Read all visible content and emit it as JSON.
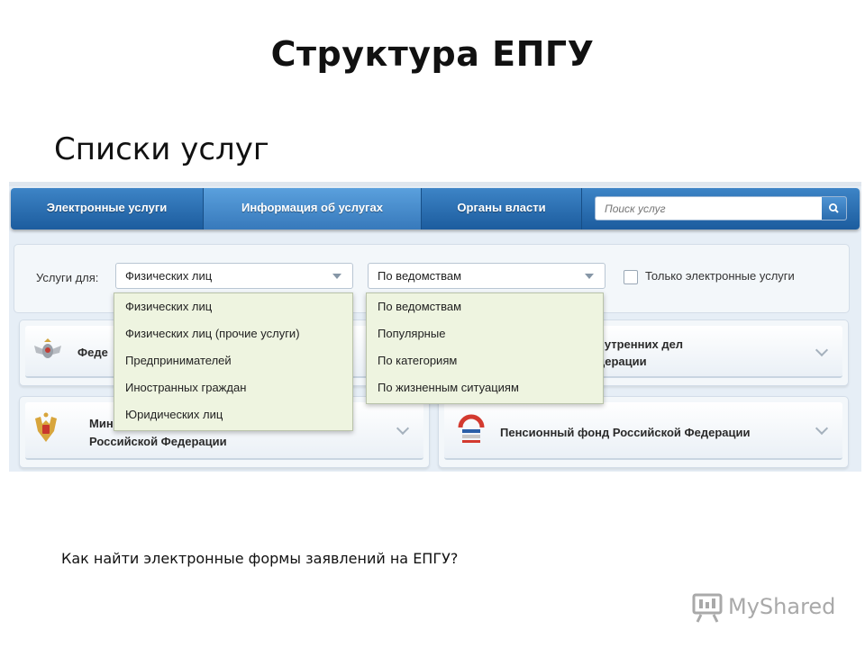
{
  "slide": {
    "title": "Структура ЕПГУ",
    "subtitle": "Списки услуг",
    "caption": "Как найти электронные формы заявлений на ЕПГУ?",
    "watermark": "MyShared"
  },
  "nav": {
    "tabs": [
      {
        "label": "Электронные услуги",
        "active": false
      },
      {
        "label": "Информация об услугах",
        "active": true
      },
      {
        "label": "Органы власти",
        "active": false
      }
    ],
    "search_placeholder": "Поиск услуг"
  },
  "filter": {
    "label": "Услуги для:",
    "select1": {
      "value": "Физических лиц",
      "options": [
        "Физических лиц",
        "Физических лиц (прочие услуги)",
        "Предпринимателей",
        "Иностранных граждан",
        "Юридических лиц"
      ]
    },
    "select2": {
      "value": "По ведомствам",
      "options": [
        "По ведомствам",
        "Популярные",
        "По категориям",
        "По жизненным ситуациям"
      ]
    },
    "checkbox_label": "Только электронные услуги",
    "checkbox_checked": false
  },
  "cards": {
    "top_left": "Феде",
    "top_right_line1": "нутренних дел",
    "top_right_line2": "дерации",
    "bottom_left_line1": "Мини",
    "bottom_left_line2": "Российской Федерации",
    "bottom_right": "Пенсионный фонд Российской Федерации"
  },
  "icons": {
    "search": "search-icon",
    "chevron": "chevron-down-icon",
    "caret": "caret-down-icon"
  },
  "colors": {
    "nav_blue": "#1c5c9e",
    "nav_active": "#3779bb",
    "dropdown_bg": "#eef4e0"
  }
}
